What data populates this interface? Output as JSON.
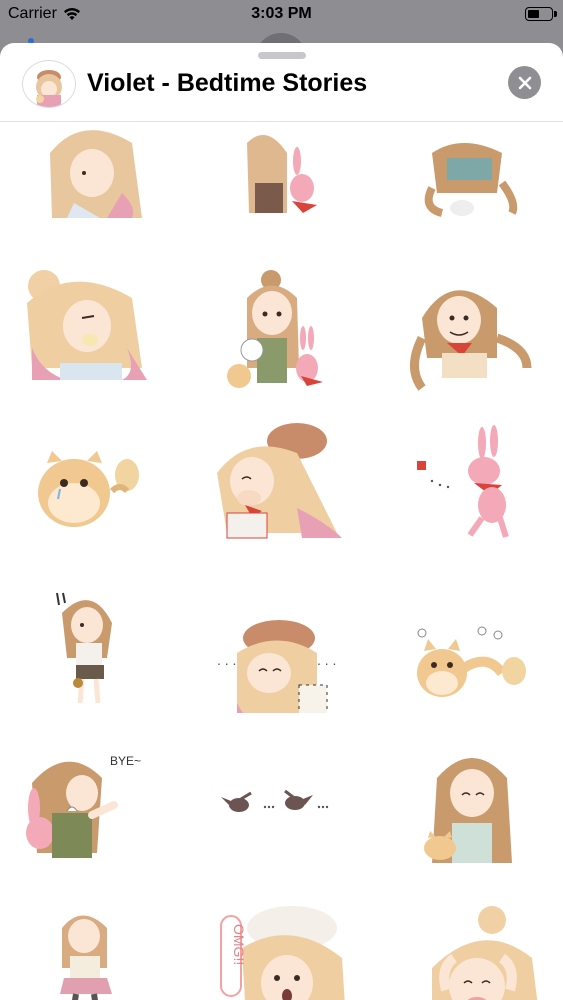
{
  "status_bar": {
    "carrier": "Carrier",
    "time": "3:03 PM",
    "wifi_icon": "wifi-icon",
    "battery_icon": "battery-icon"
  },
  "sheet": {
    "title": "Violet - Bedtime Stories",
    "app_icon": "sticker-app-icon",
    "close_icon": "close-icon"
  },
  "sticker_texts": {
    "bye": "BYE~",
    "omg": "OMG!!",
    "dots_left": ". . .",
    "dots_right": ". . ."
  },
  "stickers": [
    "girl-cropped-top-left",
    "girl-with-bunny-cropped",
    "girl-braids-cropped",
    "girl-bun-chewing",
    "girl-with-dog-cat-bunny",
    "girl-braids-scarf",
    "crying-cat",
    "girl-beret-covering-mouth",
    "pink-bunny-running",
    "girl-standing-surprised",
    "girl-beret-dots",
    "cat-chasing",
    "girl-bunny-bye",
    "birds-dots",
    "girl-long-hair-cat",
    "girl-pink-skirt",
    "girl-omg",
    "girl-bun-crying"
  ],
  "colors": {
    "hair": "#e8c79f",
    "hair_shadow": "#c89a6c",
    "hair_pink": "#e8a0b4",
    "skin": "#fbe6d6",
    "blush": "#f2a2a2",
    "accent_red": "#d9433a",
    "bunny": "#f4a9b8",
    "cat": "#f1c88f",
    "sheet_bg": "#ffffff",
    "overlay_bg": "#8d8d92"
  }
}
